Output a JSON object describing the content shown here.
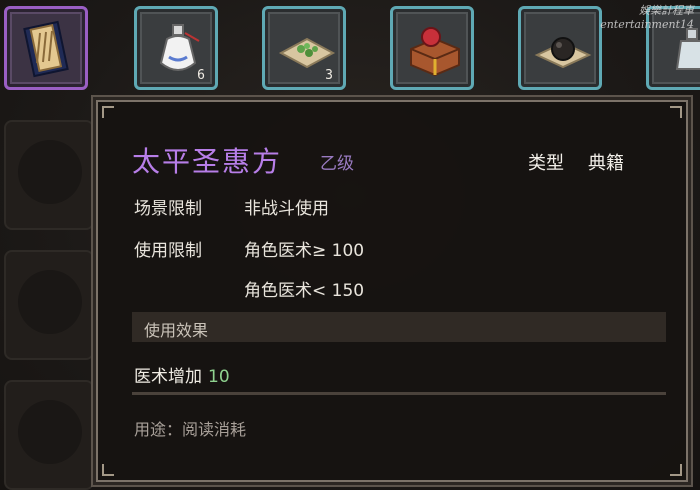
{
  "watermark": {
    "line1": "娛樂計程車",
    "line2": "entertainment14"
  },
  "inventory": {
    "slots": [
      {
        "name": "scroll-book",
        "count": "",
        "selected": true
      },
      {
        "name": "porcelain-bottle",
        "count": "6",
        "selected": false
      },
      {
        "name": "herb-pile",
        "count": "3",
        "selected": false
      },
      {
        "name": "gift-box",
        "count": "",
        "selected": false
      },
      {
        "name": "black-orb",
        "count": "",
        "selected": false
      },
      {
        "name": "glass-vial",
        "count": "",
        "selected": false
      }
    ]
  },
  "tooltip": {
    "title": "太平圣惠方",
    "grade": "乙级",
    "type_label": "类型",
    "type_value": "典籍",
    "scene_label": "场景限制",
    "scene_value": "非战斗使用",
    "use_label": "使用限制",
    "use_value_1": "角色医术≥ 100",
    "use_value_2": "角色医术< 150",
    "effect_header": "使用效果",
    "stat_label": "医术增加",
    "stat_value": "10",
    "usage": "用途：阅读消耗"
  },
  "colors": {
    "title": "#b77ee8",
    "accent_slot": "#5fa9b4",
    "selected_slot": "#9a5fc4",
    "stat_value": "#8fd28f"
  }
}
